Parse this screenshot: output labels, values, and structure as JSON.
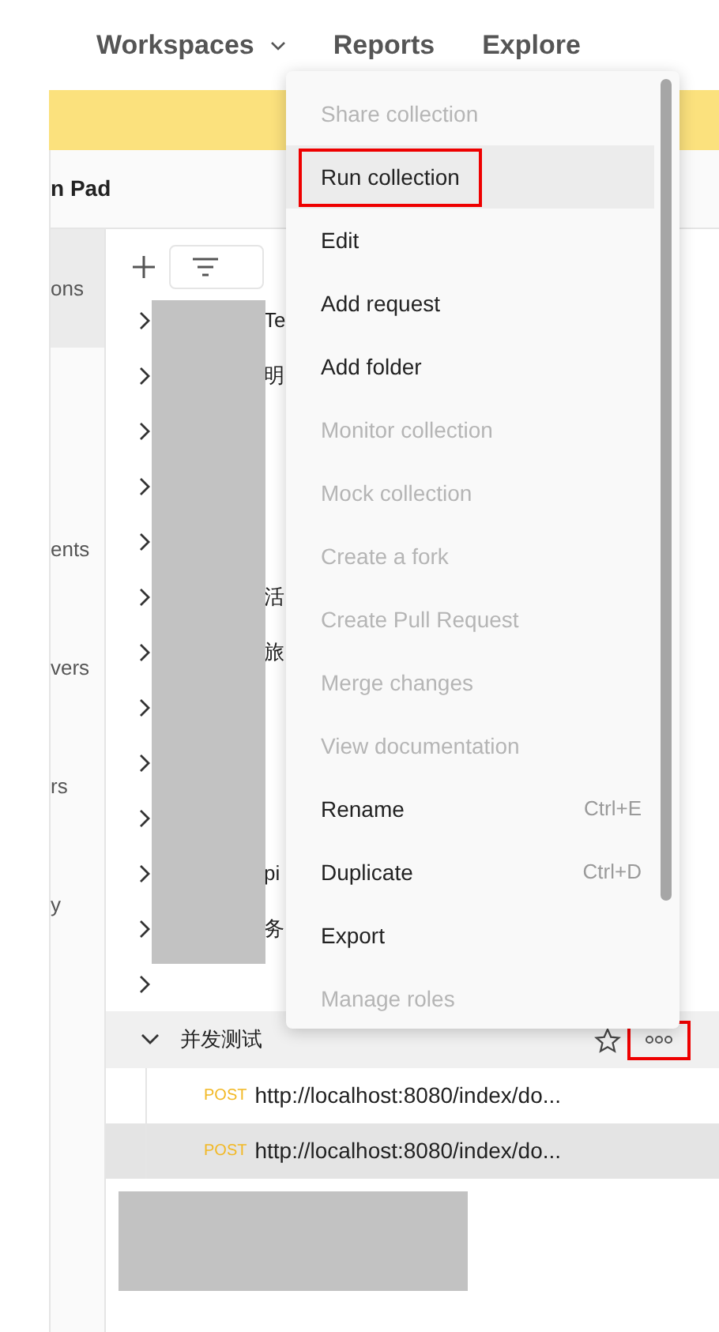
{
  "nav": [
    {
      "label": "Workspaces",
      "dropdown": true
    },
    {
      "label": "Reports",
      "dropdown": false
    },
    {
      "label": "Explore",
      "dropdown": false
    }
  ],
  "workspace_title": "n Pad",
  "sidebar": [
    {
      "label": "ons",
      "selected": true
    },
    {
      "label": "ents",
      "selected": false
    },
    {
      "label": "vers",
      "selected": false
    },
    {
      "label": "rs",
      "selected": false
    },
    {
      "label": "y",
      "selected": false
    }
  ],
  "collections": [
    {
      "name": "Te",
      "expanded": false
    },
    {
      "name": "明",
      "expanded": false
    },
    {
      "expanded": false
    },
    {
      "expanded": false
    },
    {
      "expanded": false
    },
    {
      "name": "活",
      "expanded": false
    },
    {
      "name": "旅",
      "expanded": false
    },
    {
      "expanded": false
    },
    {
      "expanded": false
    },
    {
      "expanded": false
    },
    {
      "name": "pi",
      "expanded": false
    },
    {
      "name": "务",
      "expanded": false
    },
    {
      "expanded": false
    }
  ],
  "menu": [
    {
      "label": "Share collection",
      "disabled": true,
      "highlighted": false
    },
    {
      "label": "Run collection",
      "disabled": false,
      "highlighted": true
    },
    {
      "label": "Edit",
      "disabled": false,
      "highlighted": false
    },
    {
      "label": "Add request",
      "disabled": false,
      "highlighted": false
    },
    {
      "label": "Add folder",
      "disabled": false,
      "highlighted": false
    },
    {
      "label": "Monitor collection",
      "disabled": true,
      "highlighted": false
    },
    {
      "label": "Mock collection",
      "disabled": true,
      "highlighted": false
    },
    {
      "label": "Create a fork",
      "disabled": true,
      "highlighted": false
    },
    {
      "label": "Create Pull Request",
      "disabled": true,
      "highlighted": false
    },
    {
      "label": "Merge changes",
      "disabled": true,
      "highlighted": false
    },
    {
      "label": "View documentation",
      "disabled": true,
      "highlighted": false
    },
    {
      "label": "Rename",
      "shortcut": "Ctrl+E",
      "disabled": false,
      "highlighted": false
    },
    {
      "label": "Duplicate",
      "shortcut": "Ctrl+D",
      "disabled": false,
      "highlighted": false
    },
    {
      "label": "Export",
      "disabled": false,
      "highlighted": false
    },
    {
      "label": "Manage roles",
      "disabled": true,
      "highlighted": false
    }
  ],
  "folder": {
    "name": "并发测试",
    "expanded": true,
    "highlighted": true,
    "requests": [
      {
        "method": "POST",
        "url": "http://localhost:8080/index/do...",
        "selected": false
      },
      {
        "method": "POST",
        "url": "http://localhost:8080/index/do...",
        "selected": true
      }
    ]
  }
}
